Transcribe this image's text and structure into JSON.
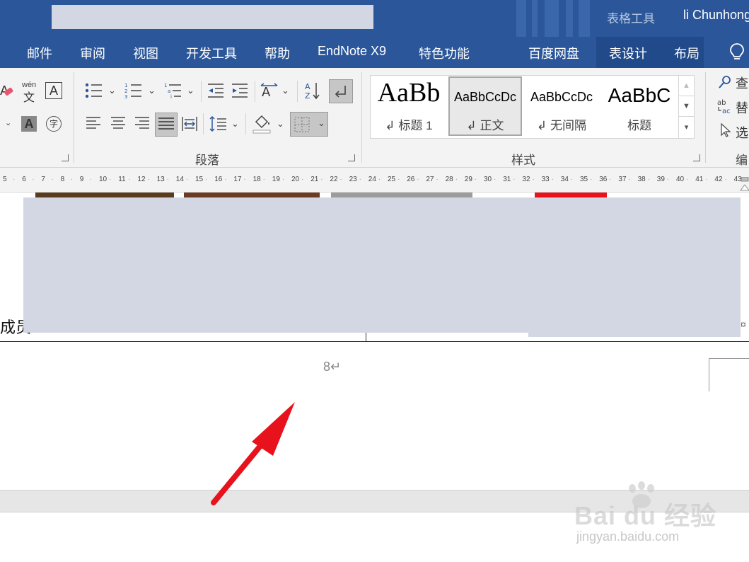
{
  "title_bar": {
    "context_tool": "表格工具",
    "user_name": "li Chunhong"
  },
  "tabs": [
    "邮件",
    "审阅",
    "视图",
    "开发工具",
    "帮助",
    "EndNote X9",
    "特色功能",
    "百度网盘",
    "表设计",
    "布局"
  ],
  "ribbon": {
    "font_group": {
      "wen_label": "wén",
      "wen_char": "文",
      "a_char": "A",
      "zi_char": "字"
    },
    "paragraph_group": {
      "label": "段落"
    },
    "styles_group": {
      "label": "样式",
      "styles": [
        {
          "preview": "AaBb",
          "name": "↲ 标题 1"
        },
        {
          "preview": "AaBbCcDc",
          "name": "↲ 正文"
        },
        {
          "preview": "AaBbCcDc",
          "name": "↲ 无间隔"
        },
        {
          "preview": "AaBbC",
          "name": "标题"
        }
      ]
    },
    "editing_group": {
      "find": "查",
      "replace": "替",
      "select": "选",
      "label": "编"
    }
  },
  "ruler": {
    "ticks": [
      "5",
      "6",
      "7",
      "8",
      "9",
      "10",
      "11",
      "12",
      "13",
      "14",
      "15",
      "16",
      "17",
      "18",
      "19",
      "20",
      "21",
      "22",
      "23",
      "24",
      "25",
      "26",
      "27",
      "28",
      "29",
      "30",
      "31",
      "32",
      "33",
      "34",
      "35",
      "36",
      "37",
      "38",
      "39",
      "40",
      "41",
      "42",
      "43"
    ]
  },
  "document": {
    "partial_text": "成员",
    "page_number": "8↵"
  },
  "watermark": {
    "brand": "Bai du 经验",
    "url": "jingyan.baidu.com"
  },
  "colors": {
    "ribbon_blue": "#2b579a",
    "redaction": "#d3d7e3",
    "arrow_red": "#e8121c"
  }
}
